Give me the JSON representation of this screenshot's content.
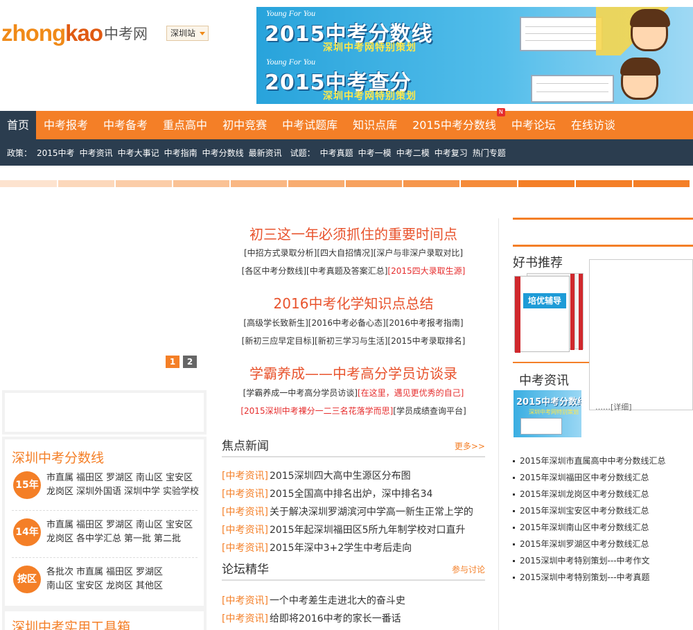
{
  "header": {
    "logo_latin_a": "zhong",
    "logo_latin_b": "kao",
    "logo_cn": "中考网",
    "site_badge": "深圳站"
  },
  "banners": [
    {
      "young": "Young For You",
      "title": "2015中考分数线",
      "subtitle": "深圳中考网特别策划"
    },
    {
      "young": "Young For You",
      "title": "2015中考查分",
      "subtitle": "深圳中考网特别策划"
    }
  ],
  "nav": {
    "items": [
      "首页",
      "中考报考",
      "中考备考",
      "重点高中",
      "初中竞赛",
      "中考试题库",
      "知识点库",
      "2015中考分数线",
      "中考论坛",
      "在线访谈"
    ],
    "new_tag": "N"
  },
  "subnav": {
    "items": [
      "政策：",
      "2015中考",
      "中考资讯",
      "中考大事记",
      "中考指南",
      "中考分数线",
      "最新资讯",
      "试题：",
      "中考真题",
      "中考一模",
      "中考二模",
      "中考复习",
      "热门专题"
    ]
  },
  "pager": [
    "1",
    "2"
  ],
  "headlines": [
    {
      "title": "初三这一年必须抓住的重要时间点",
      "row1": [
        "[中招方式录取分析]",
        "[四大自招情况]",
        "[深户与非深户录取对比]"
      ],
      "row2": [
        "[各区中考分数线]",
        "[中考真题及答案汇总]"
      ],
      "row2_red": "[2015四大录取生源]"
    },
    {
      "title": "2016中考化学知识点总结",
      "row1": [
        "[高级学长致新生]",
        "[2016中考必备心态]",
        "[2016中考报考指南]"
      ],
      "row2": [
        "[新初三应早定目标]",
        "[新初三学习与生活]",
        "[2015中考录取排名]"
      ]
    },
    {
      "title": "学霸养成——中考高分学员访谈录",
      "row1": [
        "[学霸养成一中考高分学员访谈]"
      ],
      "row1_red": "[在这里，遇见更优秀的自己]",
      "row2_red": "[2015深圳中考裸分一二三名花落学而思]",
      "row2_tail": "[学员成绩查询平台]"
    }
  ],
  "focus_news": {
    "title": "焦点新闻",
    "more": "更多>>",
    "items": [
      {
        "cat": "[中考资讯]",
        "text": "2015深圳四大高中生源区分布图"
      },
      {
        "cat": "[中考资讯]",
        "text": "2015全国高中排名出炉，深中排名34"
      },
      {
        "cat": "[中考资讯]",
        "text": "关于解决深圳罗湖滨河中学高一新生正常上学的"
      },
      {
        "cat": "[中考资讯]",
        "text": "2015年起深圳福田区5所九年制学校对口直升"
      },
      {
        "cat": "[中考资讯]",
        "text": "2015年深中3+2学生中考后走向"
      }
    ]
  },
  "forum": {
    "title": "论坛精华",
    "more": "参与讨论",
    "items": [
      {
        "cat": "[中考资讯]",
        "text": "一个中考差生走进北大的奋斗史"
      },
      {
        "cat": "[中考资讯]",
        "text": "给即将2016中考的家长一番话"
      }
    ]
  },
  "score_box": {
    "title": "深圳中考分数线",
    "groups": [
      {
        "badge": "15年",
        "line1": [
          "市直属",
          "福田区",
          "罗湖区",
          "南山区",
          "宝安区"
        ],
        "line2": [
          "龙岗区",
          "深圳外国语",
          "深圳中学",
          "实验学校"
        ]
      },
      {
        "badge": "14年",
        "line1": [
          "市直属",
          "福田区",
          "罗湖区",
          "南山区",
          "宝安区"
        ],
        "line2": [
          "龙岗区",
          "各中学汇总",
          "第一批",
          "第二批"
        ]
      },
      {
        "badge": "按区",
        "line1": [
          "各批次",
          "市直属",
          "福田区",
          "罗湖区"
        ],
        "line2": [
          "南山区",
          "宝安区",
          "龙岗区",
          "其他区"
        ]
      }
    ]
  },
  "tools_box": {
    "title": "深圳中考实用工具箱"
  },
  "right": {
    "books_title": "好书推荐",
    "book_band": "培优辅导",
    "news_title": "中考资讯",
    "popup_detail": "……[详细]",
    "thumb_title": "2015中考分数线",
    "thumb_sub": "深圳中考网特别策划",
    "list": [
      "2015年深圳市直属高中中考分数线汇总",
      "2015年深圳福田区中考分数线汇总",
      "2015年深圳龙岗区中考分数线汇总",
      "2015年深圳宝安区中考分数线汇总",
      "2015年深圳南山区中考分数线汇总",
      "2015年深圳罗湖区中考分数线汇总",
      "2015深圳中考特别策划---中考作文",
      "2015深圳中考特别策划---中考真题"
    ]
  },
  "colors": {
    "accent": "#f47f27",
    "dark": "#2b3d4f",
    "red": "#e62d2d"
  }
}
